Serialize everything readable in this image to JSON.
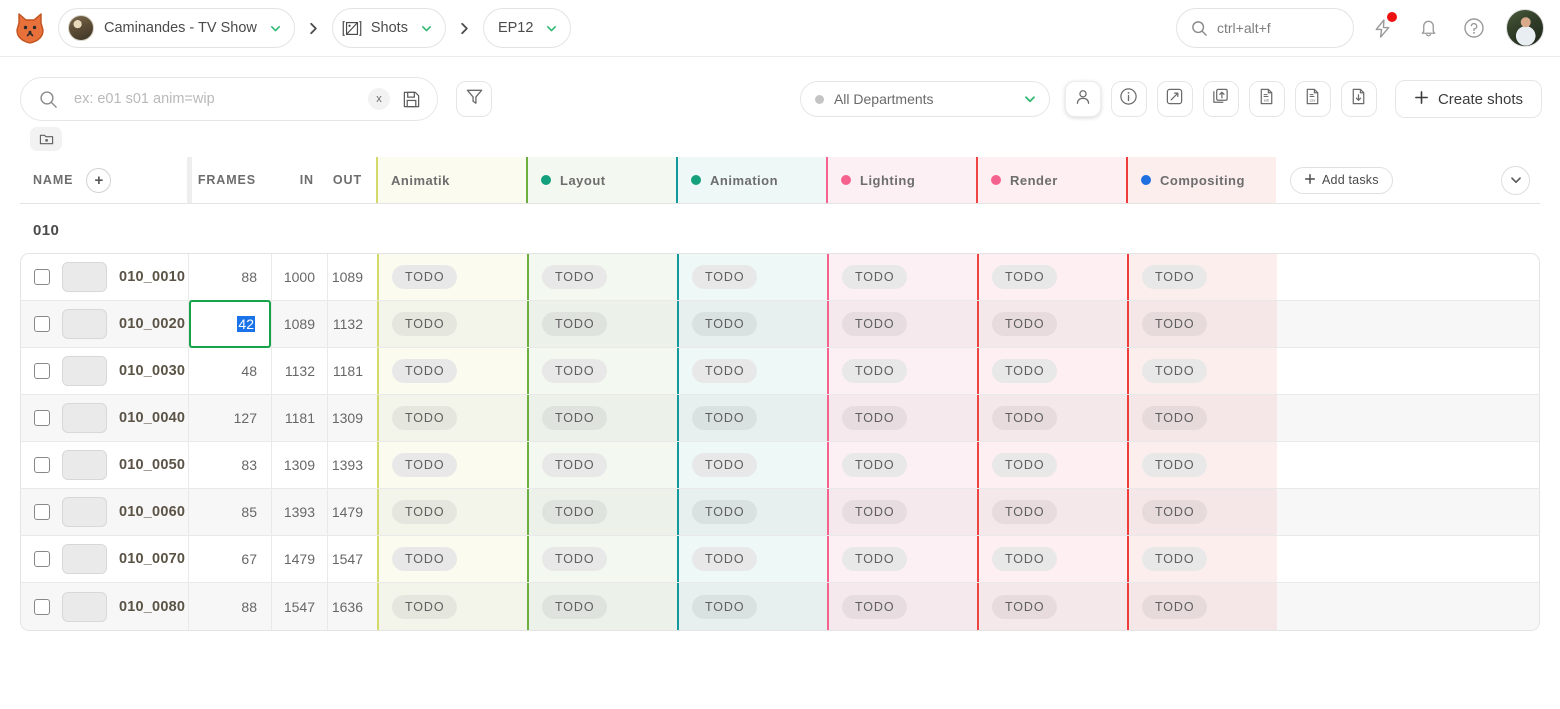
{
  "topbar": {
    "logo_icon": "fox-logo-icon",
    "breadcrumbs": [
      {
        "label": "Caminandes - TV Show",
        "icon": "project-avatar",
        "chevron": "chevron-down-icon"
      },
      {
        "label": "Shots",
        "icon": "clapperboard-icon",
        "chevron": "chevron-down-icon"
      },
      {
        "label": "EP12",
        "icon": "",
        "chevron": "chevron-down-icon"
      }
    ],
    "separator_icon": "chevron-right-icon",
    "search": {
      "icon": "search-icon",
      "text": "ctrl+alt+f"
    },
    "actions": [
      {
        "name": "flash-icon",
        "badge": true
      },
      {
        "name": "bell-icon",
        "badge": false
      },
      {
        "name": "help-circle-icon",
        "badge": false
      }
    ],
    "avatar": "user-avatar"
  },
  "toolbar": {
    "search": {
      "icon": "search-icon",
      "value": "",
      "placeholder": "ex: e01 s01 anim=wip",
      "clear_label": "x",
      "save_icon": "floppy-disk-icon"
    },
    "filter_icon": "funnel-icon",
    "folder_icon": "folder-add-icon",
    "department": {
      "label": "All Departments",
      "dot_color": "#c4c4c4",
      "chevron": "chevron-down-icon"
    },
    "icon_buttons": [
      {
        "name": "person-icon",
        "active": true
      },
      {
        "name": "info-circle-icon",
        "active": false
      },
      {
        "name": "expand-icon",
        "active": false
      },
      {
        "name": "layers-upload-icon",
        "active": false
      },
      {
        "name": "file-edl-icon",
        "active": false
      },
      {
        "name": "file-csv-icon",
        "active": false
      },
      {
        "name": "file-download-icon",
        "active": false
      }
    ],
    "create_button": {
      "label": "Create shots",
      "icon": "plus-icon"
    }
  },
  "table": {
    "headers": {
      "name": "NAME",
      "name_add_icon": "plus-circle-icon",
      "frames": "FRAMES",
      "in": "IN",
      "out": "OUT"
    },
    "task_columns": [
      {
        "label": "Animatik",
        "dot": "",
        "border": "#d4d96b",
        "bg": "#fbfcef",
        "bg_odd": "#f3f4ea"
      },
      {
        "label": "Layout",
        "dot": "#13a07c",
        "border": "#6cae3f",
        "bg": "#f3f9f1",
        "bg_odd": "#ecf1ea"
      },
      {
        "label": "Animation",
        "dot": "#13a07c",
        "border": "#11999e",
        "bg": "#eef8f7",
        "bg_odd": "#e7f0ef"
      },
      {
        "label": "Lighting",
        "dot": "#f4628d",
        "border": "#f4628d",
        "bg": "#fdf0f4",
        "bg_odd": "#f5e9ed"
      },
      {
        "label": "Render",
        "dot": "#f4628d",
        "border": "#ef4444",
        "bg": "#fdeff2",
        "bg_odd": "#f5e8eb"
      },
      {
        "label": "Compositing",
        "dot": "#1f6fe0",
        "border": "#ef3b3b",
        "bg": "#fdeeee",
        "bg_odd": "#f5e7e7"
      }
    ],
    "add_tasks": {
      "label": "Add tasks",
      "icon": "plus-icon"
    },
    "collapse_icon": "chevron-down-icon",
    "sequence_label": "010",
    "status_label": "TODO",
    "editing": {
      "row": 1,
      "column": "frames",
      "value": "42"
    },
    "rows": [
      {
        "name": "010_0010",
        "frames": "88",
        "in": "1000",
        "out": "1089"
      },
      {
        "name": "010_0020",
        "frames": "42",
        "in": "1089",
        "out": "1132"
      },
      {
        "name": "010_0030",
        "frames": "48",
        "in": "1132",
        "out": "1181"
      },
      {
        "name": "010_0040",
        "frames": "127",
        "in": "1181",
        "out": "1309"
      },
      {
        "name": "010_0050",
        "frames": "83",
        "in": "1309",
        "out": "1393"
      },
      {
        "name": "010_0060",
        "frames": "85",
        "in": "1393",
        "out": "1479"
      },
      {
        "name": "010_0070",
        "frames": "67",
        "in": "1479",
        "out": "1547"
      },
      {
        "name": "010_0080",
        "frames": "88",
        "in": "1547",
        "out": "1636"
      }
    ]
  }
}
